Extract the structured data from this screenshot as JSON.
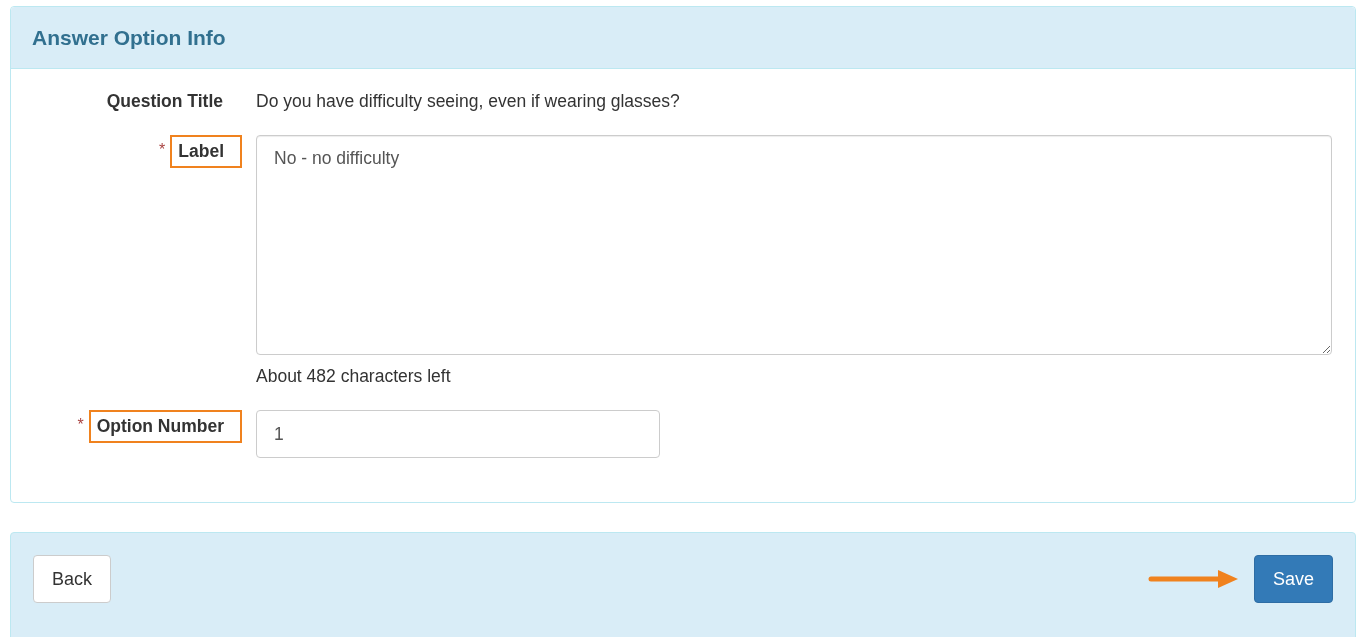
{
  "panel": {
    "title": "Answer Option Info",
    "fields": [
      {
        "kind": "static",
        "label": "Question Title",
        "value": "Do you have difficulty seeing, even if wearing glasses?",
        "highlighted": false
      },
      {
        "kind": "textarea",
        "required_mark": "*",
        "label": "Label",
        "value": "No - no difficulty",
        "help": "About 482 characters left",
        "highlighted": true
      },
      {
        "kind": "input",
        "required_mark": "*",
        "label": "Option Number",
        "value": "1",
        "highlighted": true
      }
    ]
  },
  "footer": {
    "buttons": [
      {
        "label": "Back",
        "kind": "default",
        "highlighted": false
      },
      {
        "label": "Save",
        "kind": "primary",
        "highlighted": true
      }
    ]
  }
}
